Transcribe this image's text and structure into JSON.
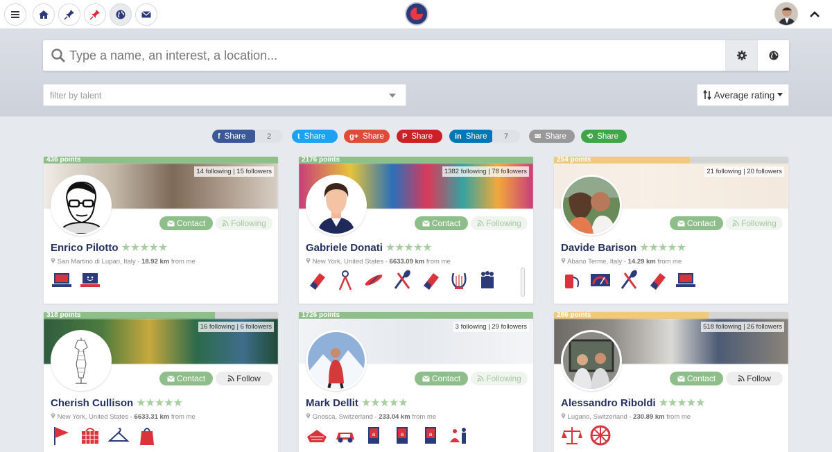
{
  "nav": {
    "menu_icon": "menu-icon",
    "buttons": [
      "home-icon",
      "pin-icon",
      "pin-red-icon",
      "globe-icon",
      "envelope-icon"
    ]
  },
  "search": {
    "placeholder": "Type a name, an interest, a location...",
    "filter_placeholder": "filter by talent",
    "sort_label": "Average rating"
  },
  "share": {
    "buttons": [
      {
        "network": "Facebook",
        "label": "Share",
        "icon": "f",
        "color": "#3b5998",
        "count": "2"
      },
      {
        "network": "Twitter",
        "label": "Share",
        "icon": "t",
        "color": "#1da1f2"
      },
      {
        "network": "Google+",
        "label": "Share",
        "icon": "g+",
        "color": "#dd4b39"
      },
      {
        "network": "Pinterest",
        "label": "Share",
        "icon": "P",
        "color": "#cb2027"
      },
      {
        "network": "LinkedIn",
        "label": "Share",
        "icon": "in",
        "color": "#0077b5",
        "count": "7"
      },
      {
        "network": "Email",
        "label": "Share",
        "icon": "✉",
        "color": "#999999"
      },
      {
        "network": "ShareThis",
        "label": "Share",
        "icon": "⟲",
        "color": "#3fa648"
      }
    ]
  },
  "profiles": [
    {
      "points": "436 points",
      "points_fraction": 1.0,
      "bar_color": "#8ebf8a",
      "stats": "14 following | 15 followers",
      "contact": "Contact",
      "follow": "Following",
      "follow_state": "following",
      "name": "Enrico Pilotto",
      "stars": "★★★★★",
      "place": "San Martino di Lupari, Italy - ",
      "distance": "18.92 km",
      "suffix": " from me",
      "talents": [
        "laptop-icon",
        "laptop-smile-icon"
      ]
    },
    {
      "points": "2176 points",
      "points_fraction": 1.0,
      "bar_color": "#8ebf8a",
      "stats": "1382 following | 78 followers",
      "contact": "Contact",
      "follow": "Following",
      "follow_state": "following",
      "name": "Gabriele Donati",
      "stars": "★★★★★",
      "place": "New York, United States - ",
      "distance": "6633.09 km",
      "suffix": " from me",
      "talents": [
        "eraser-icon",
        "compass-icon",
        "surfboard-icon",
        "cutlery-icon",
        "eraser-icon",
        "lyre-icon",
        "people-icon"
      ]
    },
    {
      "points": "254 points",
      "points_fraction": 0.58,
      "bar_color": "#f0c97a",
      "stats": "21 following | 20 followers",
      "contact": "Contact",
      "follow": "Following",
      "follow_state": "following",
      "name": "Davide Barison",
      "stars": "★★★★★",
      "place": "Abano Terme, Italy - ",
      "distance": "14.29 km",
      "suffix": " from me",
      "talents": [
        "thread-icon",
        "gauge-icon",
        "cutlery-icon",
        "eraser-icon",
        "laptop-icon"
      ]
    },
    {
      "points": "318 points",
      "points_fraction": 0.73,
      "bar_color": "#8ebf8a",
      "stats": "16 following | 6 followers",
      "contact": "Contact",
      "follow": "Follow",
      "follow_state": "follow",
      "name": "Cherish Cullison",
      "stars": "★★★★★",
      "place": "New York, United States - ",
      "distance": "6633.31 km",
      "suffix": " from me",
      "talents": [
        "flag-icon",
        "basket-icon",
        "hanger-icon",
        "bag-icon"
      ]
    },
    {
      "points": "1726 points",
      "points_fraction": 1.0,
      "bar_color": "#8ebf8a",
      "stats": "3 following | 29 followers",
      "contact": "Contact",
      "follow": "Following",
      "follow_state": "following",
      "name": "Mark Dellit",
      "stars": "★★★★★",
      "place": "Gnosca, Switzerland - ",
      "distance": "233.04 km",
      "suffix": " from me",
      "talents": [
        "rooftop-icon",
        "car-icon",
        "book-icon",
        "book-icon",
        "book-icon",
        "meditation-icon"
      ]
    },
    {
      "points": "286 points",
      "points_fraction": 0.66,
      "bar_color": "#f0c97a",
      "stats": "518 following | 26 followers",
      "contact": "Contact",
      "follow": "Follow",
      "follow_state": "follow",
      "name": "Alessandro Riboldi",
      "stars": "★★★★★",
      "place": "Lugano, Switzerland - ",
      "distance": "230.89 km",
      "suffix": " from me",
      "talents": [
        "scales-icon",
        "wheel-icon"
      ]
    }
  ]
}
